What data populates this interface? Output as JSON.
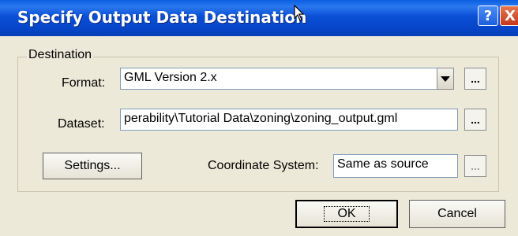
{
  "window": {
    "title": "Specify Output Data Destination",
    "help_label": "?",
    "close_label": "X"
  },
  "destination": {
    "legend": "Destination",
    "format_label": "Format:",
    "format_value": "GML Version 2.x",
    "format_browse_label": "...",
    "dataset_label": "Dataset:",
    "dataset_value": "perability\\Tutorial Data\\zoning\\zoning_output.gml",
    "dataset_browse_label": "...",
    "settings_label": "Settings...",
    "coordinate_system_label": "Coordinate System:",
    "coordinate_system_value": "Same as source",
    "coordinate_browse_label": "..."
  },
  "buttons": {
    "ok_label": "OK",
    "cancel_label": "Cancel"
  },
  "icons": {
    "cursor": "mouse-pointer-icon",
    "format_dropdown": "chevron-down-icon"
  },
  "colors": {
    "titlebar": "#0a4fd6",
    "dialog_background": "#ece9d8",
    "close_button": "#c4381b"
  }
}
